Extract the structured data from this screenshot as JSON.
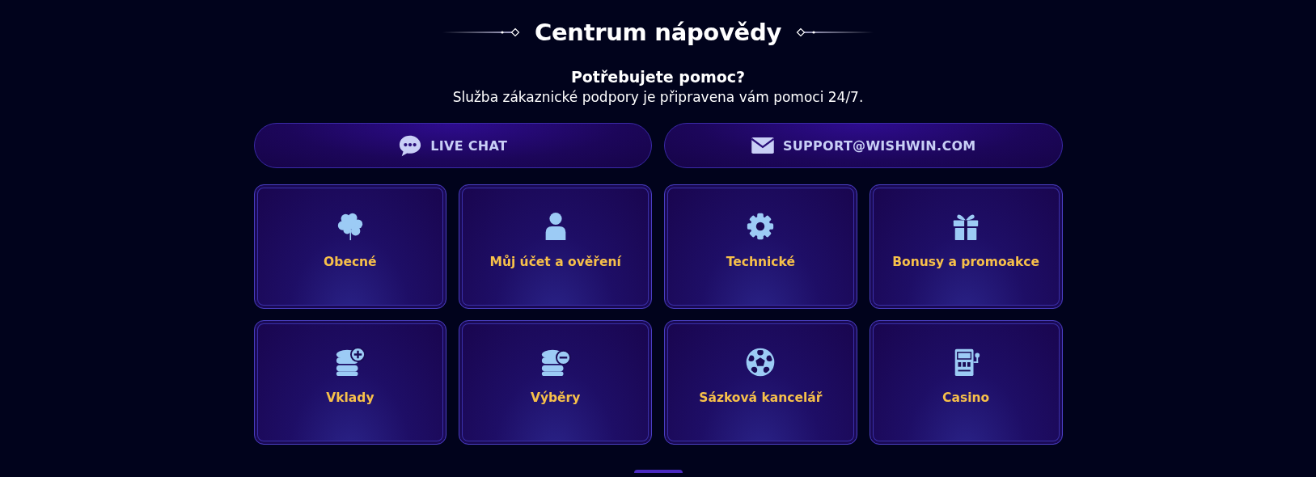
{
  "header": {
    "title": "Centrum nápovědy",
    "subtitle": "Potřebujete pomoc?",
    "description": "Služba zákaznické podpory je připravena vám pomoci 24/7."
  },
  "contact_buttons": [
    {
      "kind": "chat",
      "label": "LIVE CHAT"
    },
    {
      "kind": "email",
      "label": "SUPPORT@WISHWIN.COM"
    }
  ],
  "categories": [
    {
      "kind": "clover",
      "label": "Obecné"
    },
    {
      "kind": "user",
      "label": "Můj účet a ověření"
    },
    {
      "kind": "gear",
      "label": "Technické"
    },
    {
      "kind": "gift",
      "label": "Bonusy a promoakce"
    },
    {
      "kind": "deposit",
      "label": "Vklady"
    },
    {
      "kind": "withdraw",
      "label": "Výběry"
    },
    {
      "kind": "ball",
      "label": "Sázková kancelář"
    },
    {
      "kind": "slot",
      "label": "Casino"
    }
  ]
}
